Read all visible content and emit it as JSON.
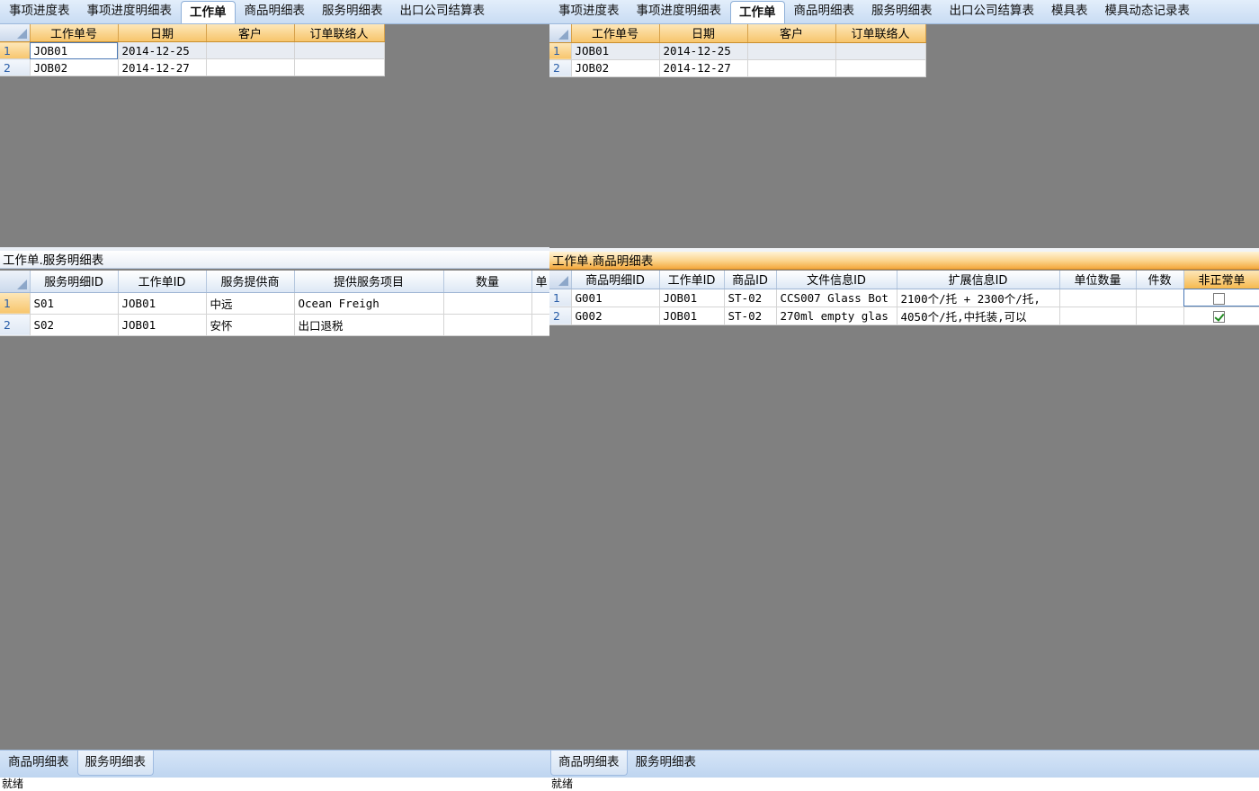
{
  "left": {
    "tabs": [
      "事项进度表",
      "事项进度明细表",
      "工作单",
      "商品明细表",
      "服务明细表",
      "出口公司结算表"
    ],
    "active_tab": 2,
    "main_grid": {
      "columns": [
        "工作单号",
        "日期",
        "客户",
        "订单联络人"
      ],
      "rows": [
        {
          "num": "1",
          "cells": [
            "JOB01",
            "2014-12-25",
            "",
            ""
          ]
        },
        {
          "num": "2",
          "cells": [
            "JOB02",
            "2014-12-27",
            "",
            ""
          ]
        }
      ]
    },
    "detail_caption": "工作单.服务明细表",
    "detail_grid": {
      "columns": [
        "服务明细ID",
        "工作单ID",
        "服务提供商",
        "提供服务项目",
        "数量",
        "单"
      ],
      "rows": [
        {
          "num": "1",
          "cells": [
            "S01",
            "JOB01",
            "中远",
            "Ocean Freigh",
            "",
            ""
          ]
        },
        {
          "num": "2",
          "cells": [
            "S02",
            "JOB01",
            "安怀",
            "出口退税",
            "",
            ""
          ]
        }
      ]
    },
    "bottom_tabs": [
      "商品明细表",
      "服务明细表"
    ],
    "status": "就绪"
  },
  "right": {
    "tabs": [
      "事项进度表",
      "事项进度明细表",
      "工作单",
      "商品明细表",
      "服务明细表",
      "出口公司结算表",
      "模具表",
      "模具动态记录表"
    ],
    "active_tab": 2,
    "main_grid": {
      "columns": [
        "工作单号",
        "日期",
        "客户",
        "订单联络人"
      ],
      "rows": [
        {
          "num": "1",
          "cells": [
            "JOB01",
            "2014-12-25",
            "",
            ""
          ]
        },
        {
          "num": "2",
          "cells": [
            "JOB02",
            "2014-12-27",
            "",
            ""
          ]
        }
      ]
    },
    "detail_caption": "工作单.商品明细表",
    "detail_grid": {
      "columns": [
        "商品明细ID",
        "工作单ID",
        "商品ID",
        "文件信息ID",
        "扩展信息ID",
        "单位数量",
        "件数",
        "非正常单"
      ],
      "rows": [
        {
          "num": "1",
          "cells": [
            "G001",
            "JOB01",
            "ST-02",
            "CCS007 Glass Bot",
            "2100个/托 + 2300个/托,",
            "",
            ""
          ],
          "checked": false
        },
        {
          "num": "2",
          "cells": [
            "G002",
            "JOB01",
            "ST-02",
            "270ml empty glas",
            "4050个/托,中托装,可以",
            "",
            ""
          ],
          "checked": true
        }
      ]
    },
    "bottom_tabs": [
      "商品明细表",
      "服务明细表"
    ],
    "status": "就绪"
  }
}
